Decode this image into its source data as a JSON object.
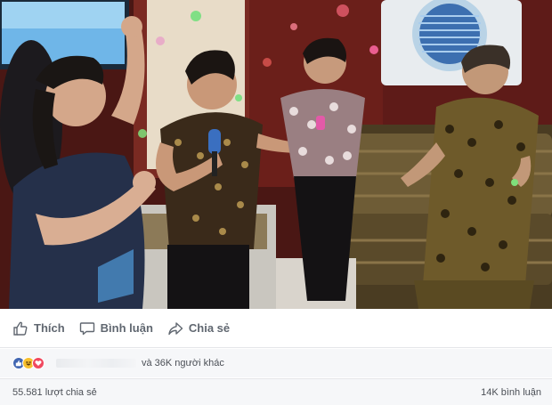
{
  "post": {
    "media": {
      "description_icon": "video-thumbnail"
    }
  },
  "actions": [
    {
      "id": "like",
      "label": "Thích",
      "icon": "thumbs-up-icon"
    },
    {
      "id": "comment",
      "label": "Bình luận",
      "icon": "comment-icon"
    },
    {
      "id": "share",
      "label": "Chia sẻ",
      "icon": "share-icon"
    }
  ],
  "reactions": {
    "icons": [
      "like-reaction-icon",
      "haha-reaction-icon",
      "love-reaction-icon"
    ],
    "summary": "và 36K người khác"
  },
  "stats": {
    "shares": "55.581 lượt chia sẻ",
    "comments": "14K bình luận"
  },
  "colors": {
    "like_blue": "#4267b2",
    "haha_yellow": "#f7c02d",
    "love_red": "#f0495f",
    "text_gray": "#606770"
  }
}
